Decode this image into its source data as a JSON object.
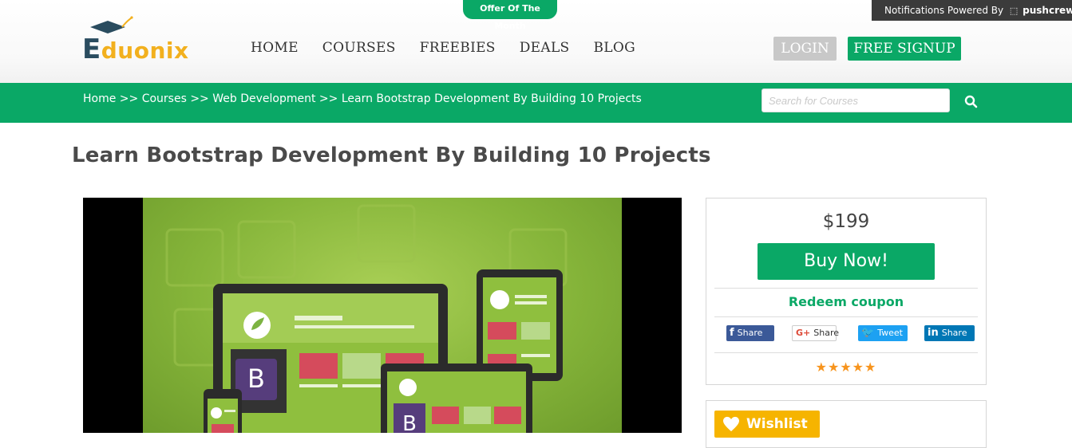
{
  "header": {
    "offer_badge": "Offer Of The Month",
    "notification_prefix": "Notifications Powered By",
    "notification_brand": "pushcrew",
    "logo": {
      "first_letter": "E",
      "rest": "duonix"
    },
    "nav": [
      "HOME",
      "COURSES",
      "FREEBIES",
      "DEALS",
      "BLOG"
    ],
    "login_label": "LOGIN",
    "signup_label": "FREE SIGNUP"
  },
  "subbar": {
    "breadcrumb": "Home >> Courses >> Web Development >> Learn Bootstrap Development By Building 10 Projects",
    "search_placeholder": "Search for Courses"
  },
  "course": {
    "title": "Learn Bootstrap Development By Building 10 Projects",
    "video_logo_letter": "B"
  },
  "purchase": {
    "price": "$199",
    "buy_label": "Buy Now!",
    "redeem_label": "Redeem coupon",
    "share": {
      "facebook": "Share",
      "google": "Share",
      "twitter": "Tweet",
      "linkedin": "Share"
    },
    "rating_stars": 5,
    "stars_text": "★★★★★",
    "wishlist_label": "Wishlist"
  },
  "colors": {
    "brand_green": "#0aa866",
    "logo_gold": "#f2b01e",
    "logo_dark": "#2a4c5f",
    "star_orange": "#f7941d",
    "wishlist_yellow": "#f6b400"
  }
}
